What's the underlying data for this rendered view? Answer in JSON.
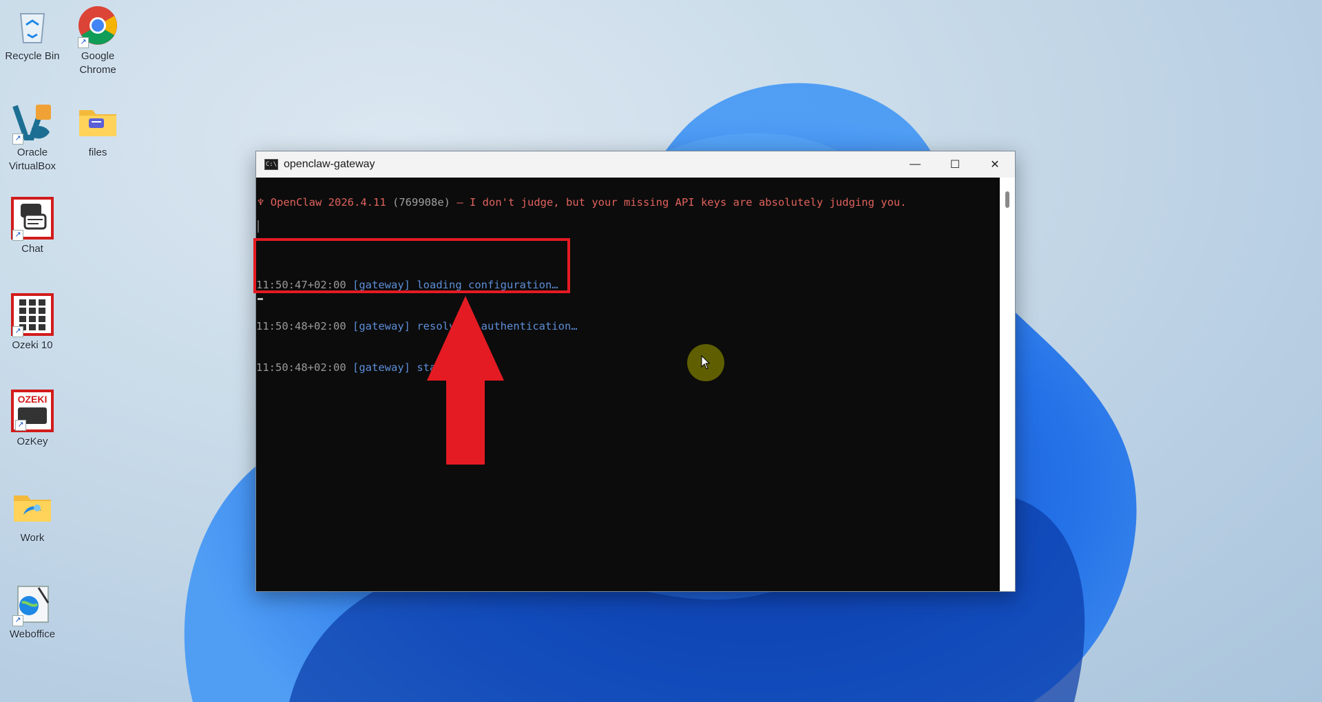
{
  "desktop": {
    "icons": [
      {
        "label": "Recycle Bin",
        "icon": "recycle-bin-icon"
      },
      {
        "label": "Google Chrome",
        "icon": "chrome-icon"
      },
      {
        "label": "Oracle VirtualBox",
        "icon": "virtualbox-icon"
      },
      {
        "label": "files",
        "icon": "folder-icon"
      },
      {
        "label": "Chat",
        "icon": "chat-icon"
      },
      {
        "label": "Ozeki 10",
        "icon": "ozeki-keypad-icon"
      },
      {
        "label": "OzKey",
        "icon": "ozkey-icon",
        "badge": "OZEKI"
      },
      {
        "label": "Work",
        "icon": "folder-icon"
      },
      {
        "label": "Weboffice",
        "icon": "weboffice-icon"
      }
    ]
  },
  "window": {
    "title": "openclaw-gateway",
    "controls": {
      "minimize": "—",
      "maximize": "☐",
      "close": "✕"
    }
  },
  "terminal": {
    "banner": {
      "glyph": "♆",
      "product": "OpenClaw 2026.4.11",
      "hash": "(769908e)",
      "tagline": "— I don't judge, but your missing API keys are absolutely judging you."
    },
    "logs": [
      {
        "ts": "11:50:47+02:00",
        "tag": "[gateway]",
        "msg": "loading configuration…"
      },
      {
        "ts": "11:50:48+02:00",
        "tag": "[gateway]",
        "msg": "resolving authentication…"
      },
      {
        "ts": "11:50:48+02:00",
        "tag": "[gateway]",
        "msg": "starting..."
      }
    ]
  },
  "annotation": {
    "color": "#e41b23"
  },
  "colors": {
    "accent": "#e0625d",
    "log": "#5d8ed8"
  }
}
